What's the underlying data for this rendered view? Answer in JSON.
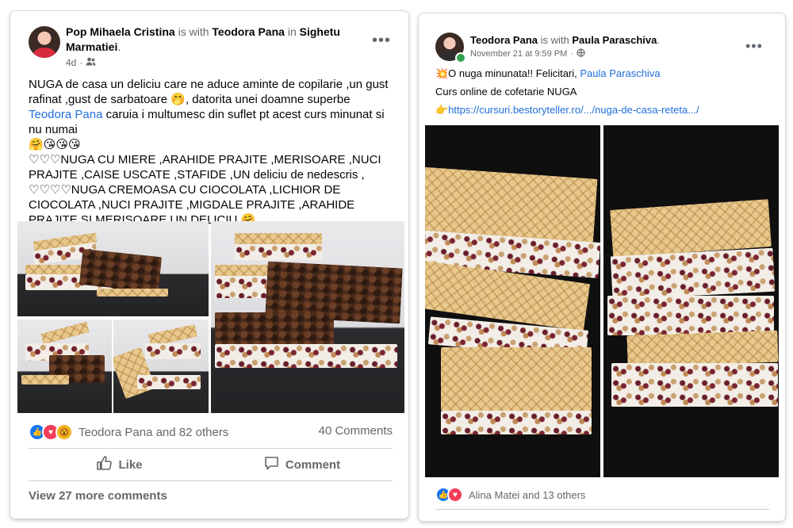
{
  "post1": {
    "author": "Pop Mihaela Cristina",
    "with_word": "is with",
    "tagged": "Teodora Pana",
    "in_word": "in",
    "location": "Sighetu Marmatiei",
    "period": ".",
    "time": "4d",
    "audience_icon": "friends-icon",
    "text": {
      "line1a": "NUGA de casa un deliciu care ne aduce aminte de copilarie ,un gust rafinat ,gust de sarbatoare 🤭,  datorita unei doamne superbe ",
      "line1_link": "Teodora Pana",
      "line1b": " caruia i multumesc din suflet pt acest curs minunat si nu numai",
      "emojis1": "🤗😘😘😘",
      "line2": "♡♡♡NUGA CU MIERE ,ARAHIDE PRAJITE ,MERISOARE ,NUCI PRAJITE ,CAISE USCATE ,STAFIDE ,UN deliciu de nedescris ,",
      "line3": "♡♡♡♡NUGA  CREMOASA CU CIOCOLATA ,LICHIOR DE CIOCOLATA ,NUCI PRAJITE ,MIGDALE PRAJITE ,ARAHIDE PRAJITE SI MERISOARE UN DELICIU 🤗"
    },
    "reactions_text": "Teodora Pana and 82 others",
    "comments_count": "40 Comments",
    "like_label": "Like",
    "comment_label": "Comment",
    "view_more": "View 27 more comments"
  },
  "post2": {
    "author": "Teodora Pana",
    "with_word": "is with",
    "tagged": "Paula Paraschiva",
    "period": ".",
    "time": "November 21 at 9:59 PM",
    "dot": "·",
    "audience_icon": "globe-icon",
    "line1_prefix": "💥O nuga minunata!! Felicitari, ",
    "line1_link": "Paula Paraschiva",
    "line2": "Curs online de cofetarie NUGA",
    "link_prefix": "👉",
    "url": "https://cursuri.bestoryteller.ro/.../nuga-de-casa-reteta.../",
    "reactions_text": "Alina Matei and 13 others"
  },
  "colors": {
    "link": "#216fdb",
    "secondary_text": "#65676b",
    "like_blue": "#1877f2",
    "love_red": "#f33e58",
    "wow_yellow": "#f7b125"
  }
}
